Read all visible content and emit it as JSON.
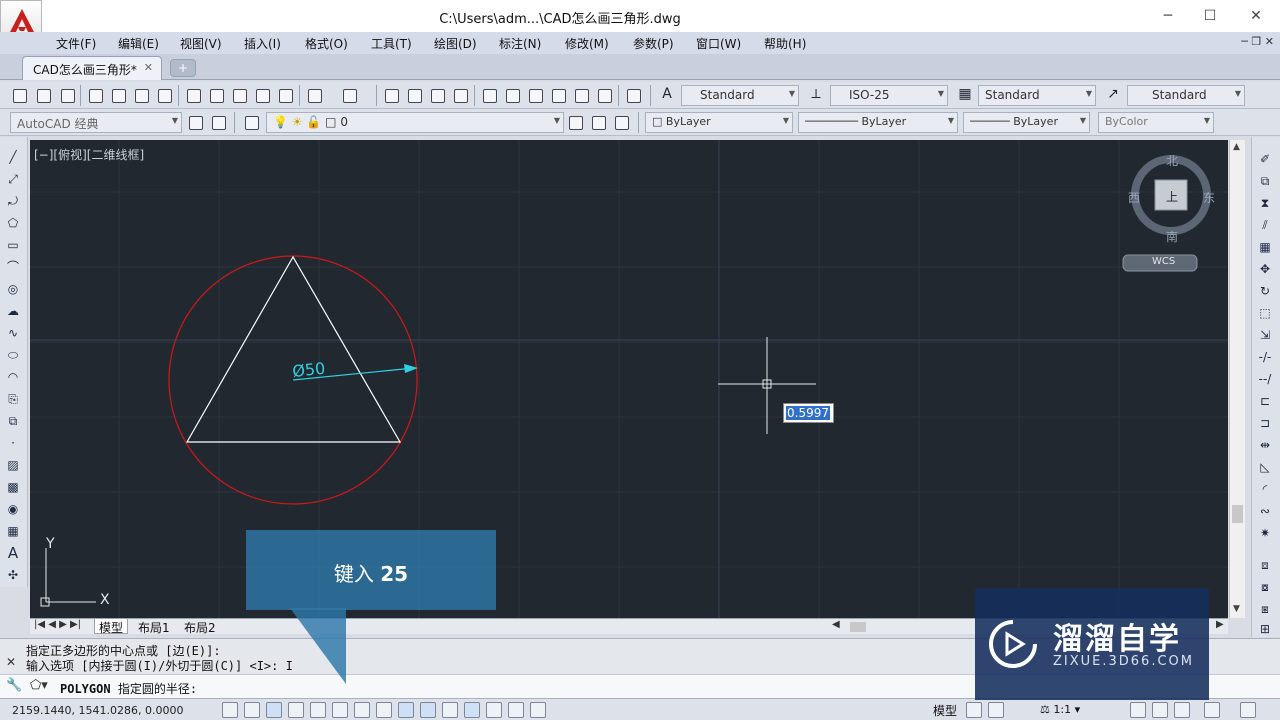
{
  "app": {
    "title": "C:\\Users\\adm...\\CAD怎么画三角形.dwg",
    "window_controls": [
      "─",
      "☐",
      "✕"
    ]
  },
  "menu": {
    "items": [
      "文件(F)",
      "编辑(E)",
      "视图(V)",
      "插入(I)",
      "格式(O)",
      "工具(T)",
      "绘图(D)",
      "标注(N)",
      "修改(M)",
      "参数(P)",
      "窗口(W)",
      "帮助(H)"
    ],
    "mdi_controls": "─ ❐ ✕"
  },
  "tabs": {
    "document": "CAD怎么画三角形*",
    "close": "✕",
    "new_tab": "+"
  },
  "toolbar": {
    "text_style": "Standard",
    "dim_style": "ISO-25",
    "table_style": "Standard",
    "multileader_style": "Standard",
    "workspace": "AutoCAD 经典",
    "layer": "0",
    "color": "ByLayer",
    "linetype": "ByLayer",
    "lineweight": "ByLayer",
    "plot_style": "ByColor"
  },
  "viewport": {
    "label": "[−][俯视][二维线框]",
    "dimension_text": "Ø50",
    "dynamic_input": "0.5997",
    "ucs_x": "X",
    "ucs_y": "Y"
  },
  "viewcube": {
    "north": "北",
    "south": "南",
    "east": "东",
    "west": "西",
    "face": "上",
    "wcs": "WCS"
  },
  "sheet_tabs": [
    "模型",
    "布局1",
    "布局2"
  ],
  "command_line": {
    "history": [
      "指定正多边形的中心点或 [边(E)]:",
      "输入选项 [内接于圆(I)/外切于圆(C)] <I>: I"
    ],
    "command": "POLYGON",
    "prompt": "指定圆的半径:"
  },
  "status": {
    "coordinates": "2159.1440,  1541.0286,  0.0000",
    "model": "模型",
    "scale": "1:1"
  },
  "overlay": {
    "callout_text": "键入",
    "callout_value": "25",
    "watermark_title": "溜溜自学",
    "watermark_url": "ZIXUE.3D66.COM"
  },
  "colors": {
    "canvas_bg": "#212830",
    "circle": "#d01818",
    "triangle": "#ffffff",
    "dimension": "#2fd0e0",
    "callout": "#2e78a8",
    "watermark": "#142e5c"
  }
}
